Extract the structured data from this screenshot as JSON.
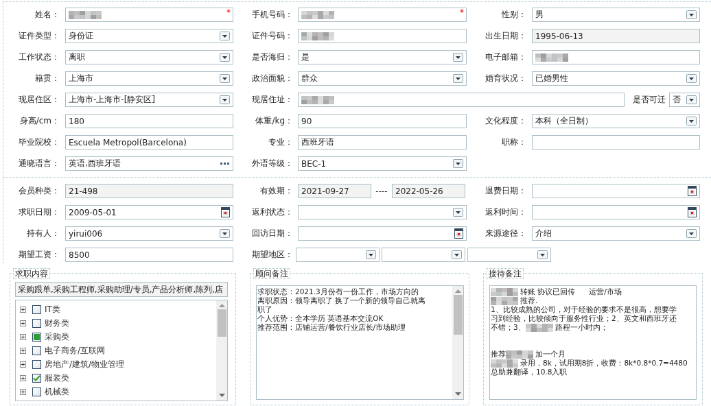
{
  "basic_info": {
    "rows": [
      {
        "kind": "standard",
        "fields": [
          {
            "label": "姓名：",
            "kind": "text",
            "redacted": true,
            "marker": "*"
          },
          {
            "label": "手机号码：",
            "kind": "text",
            "redacted": true,
            "marker": "*"
          },
          {
            "label": "性别：",
            "kind": "select",
            "value": "男"
          }
        ]
      },
      {
        "kind": "standard",
        "fields": [
          {
            "label": "证件类型：",
            "kind": "select",
            "value": "身份证"
          },
          {
            "label": "证件号码：",
            "kind": "text",
            "redacted": true
          },
          {
            "label": "出生日期：",
            "kind": "text",
            "value": "1995-06-13",
            "readonly": true
          }
        ]
      },
      {
        "kind": "standard",
        "fields": [
          {
            "label": "工作状态：",
            "kind": "select",
            "value": "离职"
          },
          {
            "label": "是否海归：",
            "kind": "select",
            "value": "是"
          },
          {
            "label": "电子邮箱：",
            "kind": "text",
            "redacted": true
          }
        ]
      },
      {
        "kind": "standard",
        "fields": [
          {
            "label": "籍贯：",
            "kind": "select",
            "value": "上海市"
          },
          {
            "label": "政治面貌：",
            "kind": "select",
            "value": "群众"
          },
          {
            "label": "婚育状况：",
            "kind": "select",
            "value": "已婚男性"
          }
        ]
      },
      {
        "kind": "wide-middle",
        "fields": [
          {
            "label": "现居住区：",
            "kind": "select",
            "value": "上海市-上海市-[静安区]"
          },
          {
            "label": "现居住址：",
            "kind": "text",
            "redacted": true
          },
          {
            "label": "是否可迁",
            "kind": "select",
            "value": "否"
          }
        ]
      },
      {
        "kind": "standard",
        "fields": [
          {
            "label": "身高/cm：",
            "kind": "text",
            "value": "180"
          },
          {
            "label": "体重/kg：",
            "kind": "text",
            "value": "90"
          },
          {
            "label": "文化程度：",
            "kind": "select",
            "value": "本科（全日制）"
          }
        ]
      },
      {
        "kind": "standard",
        "fields": [
          {
            "label": "毕业院校：",
            "kind": "text",
            "value": "Escuela Metropol(Barcelona)"
          },
          {
            "label": "专业：",
            "kind": "text",
            "value": "西班牙语"
          },
          {
            "label": "职称：",
            "kind": "text"
          }
        ]
      },
      {
        "kind": "standard",
        "fields": [
          {
            "label": "通晓语言：",
            "kind": "picker",
            "value": "英语,西班牙语"
          },
          {
            "label": "外语等级：",
            "kind": "select",
            "value": "BEC-1"
          }
        ]
      }
    ]
  },
  "membership": {
    "rows": [
      {
        "fields": [
          {
            "label": "会员种类：",
            "kind": "text",
            "value": "21-498",
            "readonly": true
          },
          {
            "label": "有效期：",
            "kind": "range",
            "values": [
              "2021-09-27",
              "2022-05-26"
            ],
            "separator": "----",
            "readonly": true
          },
          {
            "label": "退费日期：",
            "kind": "date"
          }
        ]
      },
      {
        "fields": [
          {
            "label": "求职日期：",
            "kind": "date",
            "value": "2009-05-01"
          },
          {
            "label": "返利状态：",
            "kind": "select"
          },
          {
            "label": "返利时间：",
            "kind": "date"
          }
        ]
      },
      {
        "fields": [
          {
            "label": "持有人：",
            "kind": "select",
            "value": "yirui006"
          },
          {
            "label": "回访日期：",
            "kind": "date"
          },
          {
            "label": "来源途径：",
            "kind": "select",
            "value": "介绍"
          }
        ]
      },
      {
        "fields": [
          {
            "label": "期望工资：",
            "kind": "text",
            "value": "8500"
          },
          {
            "label": "期望地区：",
            "kind": "region"
          }
        ]
      }
    ]
  },
  "job_intent": {
    "title": "求职内容",
    "summary": "采购跟单,采购工程师,采购助理/专员,产品分析师,陈列,店",
    "tree": [
      {
        "label": "IT类",
        "checked": false,
        "partial": false
      },
      {
        "label": "财务类",
        "checked": false,
        "partial": false
      },
      {
        "label": "采购类",
        "checked": false,
        "partial": true
      },
      {
        "label": "电子商务/互联网",
        "checked": false,
        "partial": false
      },
      {
        "label": "房地产/建筑/物业管理",
        "checked": false,
        "partial": false
      },
      {
        "label": "服装类",
        "checked": true,
        "partial": false
      },
      {
        "label": "机械类",
        "checked": false,
        "partial": false
      }
    ]
  },
  "consultant_notes": {
    "title": "顾问备注",
    "lines": [
      {
        "parts": [
          {
            "text": "求职状态：2021.3月份有一份工作，市场方向的"
          }
        ]
      },
      {
        "parts": [
          {
            "text": "离职原因：领导离职了 换了一个新的领导自己就离"
          }
        ]
      },
      {
        "parts": [
          {
            "text": "职了"
          }
        ]
      },
      {
        "parts": [
          {
            "text": "个人优势：全本学历 英语基本交流OK"
          }
        ]
      },
      {
        "parts": [
          {
            "text": "推荐范围：店铺运营/餐饮行业店长/市场助理"
          }
        ]
      }
    ]
  },
  "reception_notes": {
    "title": "接待备注",
    "lines": [
      {
        "parts": [
          {
            "kind": "redacted"
          },
          {
            "text": "转账 协议已回传      运营/市场"
          }
        ]
      },
      {
        "parts": [
          {
            "kind": "redacted"
          },
          {
            "text": "推荐."
          }
        ]
      },
      {
        "parts": [
          {
            "text": "1、比较成熟的公司，对于经验的要求不是很高，想要学"
          }
        ]
      },
      {
        "parts": [
          {
            "text": "习到经验，比较倾向于服务性行业；2、英文和西班牙还"
          }
        ]
      },
      {
        "parts": [
          {
            "text": "不错；3、"
          },
          {
            "kind": "redacted"
          },
          {
            "text": "路程一小时内；"
          }
        ]
      },
      {
        "kind": "blank"
      },
      {
        "kind": "blank"
      },
      {
        "parts": [
          {
            "text": "推荐"
          },
          {
            "kind": "redacted"
          },
          {
            "text": "加一个月"
          }
        ]
      },
      {
        "parts": [
          {
            "kind": "redacted"
          },
          {
            "text": "录用，8k，试用期8折，收费：8k*0.8*0.7=4480"
          }
        ]
      },
      {
        "parts": [
          {
            "text": "总助兼翻译，10.8入职"
          }
        ]
      }
    ]
  }
}
